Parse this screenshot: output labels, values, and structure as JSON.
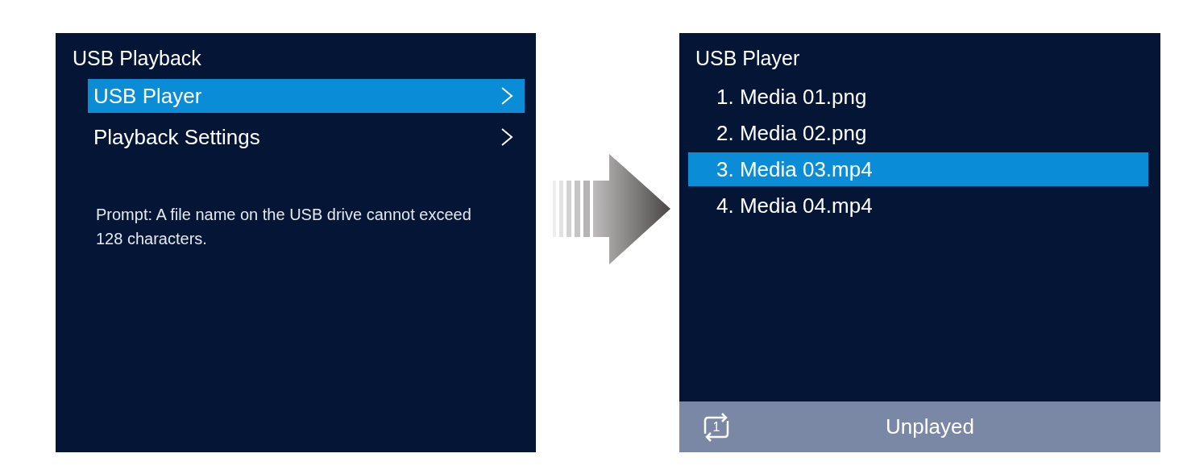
{
  "left_screen": {
    "title": "USB Playback",
    "menu": [
      {
        "label": "USB Player",
        "selected": true
      },
      {
        "label": "Playback Settings",
        "selected": false
      }
    ],
    "prompt": "Prompt: A file name on the USB drive cannot exceed 128 characters."
  },
  "right_screen": {
    "title": "USB Player",
    "files": [
      {
        "label": "1. Media 01.png",
        "selected": false
      },
      {
        "label": "2. Media 02.png",
        "selected": false
      },
      {
        "label": "3. Media 03.mp4",
        "selected": true
      },
      {
        "label": "4. Media 04.mp4",
        "selected": false
      }
    ],
    "status_bar": {
      "repeat_number": "1",
      "status": "Unplayed"
    }
  }
}
